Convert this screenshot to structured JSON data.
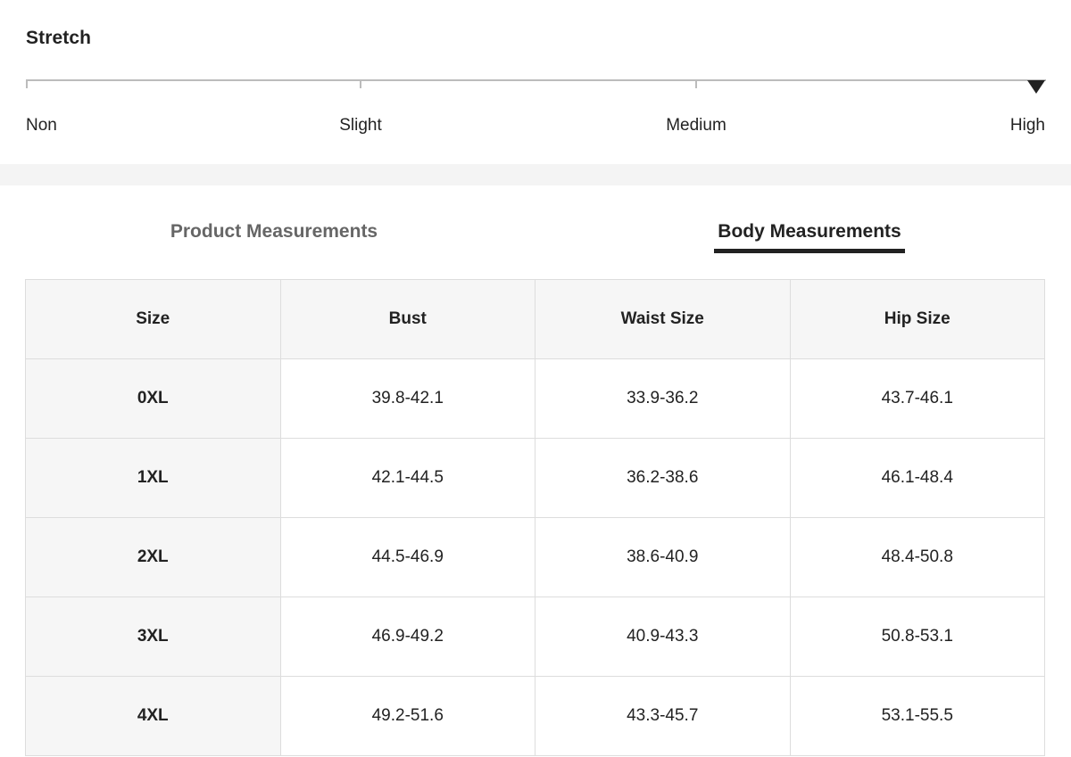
{
  "stretch": {
    "title": "Stretch",
    "levels": [
      "Non",
      "Slight",
      "Medium",
      "High"
    ],
    "selected": "High"
  },
  "tabs": {
    "product": "Product Measurements",
    "body": "Body Measurements",
    "active": "Body Measurements"
  },
  "table": {
    "headers": [
      "Size",
      "Bust",
      "Waist Size",
      "Hip Size"
    ],
    "rows": [
      [
        "0XL",
        "39.8-42.1",
        "33.9-36.2",
        "43.7-46.1"
      ],
      [
        "1XL",
        "42.1-44.5",
        "36.2-38.6",
        "46.1-48.4"
      ],
      [
        "2XL",
        "44.5-46.9",
        "38.6-40.9",
        "48.4-50.8"
      ],
      [
        "3XL",
        "46.9-49.2",
        "40.9-43.3",
        "50.8-53.1"
      ],
      [
        "4XL",
        "49.2-51.6",
        "43.3-45.7",
        "53.1-55.5"
      ]
    ]
  },
  "colors": {
    "text": "#222222",
    "inactive_tab": "#666666",
    "header_bg": "#f6f6f6",
    "border": "#dddddd",
    "scale_line": "#bcbcbc"
  }
}
